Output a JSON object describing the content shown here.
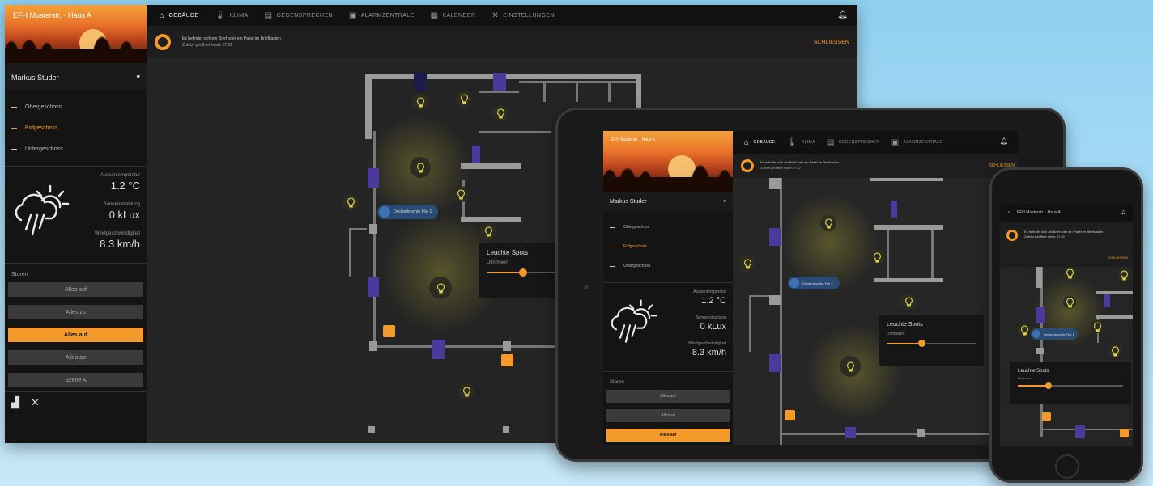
{
  "desktop": {
    "sidebar": {
      "header": "EFH Musterstr. · Haus A",
      "user": "Markus Studer",
      "floors": [
        {
          "label": "Obergeschoss",
          "active": false
        },
        {
          "label": "Erdgeschoss",
          "active": true
        },
        {
          "label": "Untergeschoss",
          "active": false
        }
      ],
      "weather": {
        "icon": "cloud-rain-sun-icon",
        "temp_label": "Aussentemperatur",
        "temp_value": "1.2 °C",
        "light_label": "Sonnenstrahlung",
        "light_value": "0 kLux",
        "wind_label": "Windgeschwindigkeit",
        "wind_value": "8.3 km/h"
      },
      "group_title": "Storen",
      "group_buttons": [
        {
          "label": "Alles auf",
          "active": false
        },
        {
          "label": "Alles zu",
          "active": false
        },
        {
          "label": "Alles auf",
          "active": true
        },
        {
          "label": "Alles ab",
          "active": false
        },
        {
          "label": "Szene A",
          "active": false
        }
      ]
    },
    "nav": [
      {
        "label": "GEBÄUDE",
        "icon": "home-icon",
        "active": true
      },
      {
        "label": "KLIMA",
        "icon": "thermometer-icon",
        "active": false
      },
      {
        "label": "GEGENSPRECHEN",
        "icon": "intercom-icon",
        "active": false
      },
      {
        "label": "ALARMZENTRALE",
        "icon": "alarm-icon",
        "active": false
      },
      {
        "label": "KALENDER",
        "icon": "calendar-icon",
        "active": false
      },
      {
        "label": "EINSTELLUNGEN",
        "icon": "tools-icon",
        "active": false
      }
    ],
    "notification": {
      "line1": "Es befindet sich ein Brief oder ein Paket im Briefkasten",
      "line2": "Zuletzt geöffnet heute 07:32",
      "close": "SCHLIESSEN"
    },
    "device_bubble": "Deckenleuchte Flur 1",
    "slider_popup": {
      "title": "Leuchte Spots",
      "subtitle": "Dimmwert",
      "value": 0.5
    }
  },
  "tablet": {
    "sidebar": {
      "header": "EFH Musterstr. · Haus A",
      "user": "Markus Studer",
      "floors": [
        {
          "label": "Obergeschoss",
          "active": false
        },
        {
          "label": "Erdgeschoss",
          "active": true
        },
        {
          "label": "Untergeschoss",
          "active": false
        }
      ],
      "weather": {
        "temp_label": "Aussentemperatur",
        "temp_value": "1.2 °C",
        "light_label": "Sonnenstrahlung",
        "light_value": "0 kLux",
        "wind_label": "Windgeschwindigkeit",
        "wind_value": "8.3 km/h"
      },
      "group_title": "Storen",
      "group_buttons": [
        {
          "label": "Alles auf",
          "active": false
        },
        {
          "label": "Alles zu",
          "active": false
        },
        {
          "label": "Alles auf",
          "active": true
        }
      ]
    },
    "nav": [
      {
        "label": "GEBÄUDE",
        "active": true
      },
      {
        "label": "KLIMA",
        "active": false
      },
      {
        "label": "GEGENSPRECHEN",
        "active": false
      },
      {
        "label": "ALARMZENTRALE",
        "active": false
      }
    ],
    "notification": {
      "line1": "Es befindet sich ein Brief oder ein Paket im Briefkasten",
      "line2": "Zuletzt geöffnet heute 07:32",
      "close": "SCHLIESSEN"
    },
    "device_bubble": "Deckenleuchte Flur 1",
    "slider_popup": {
      "title": "Leuchte Spots",
      "subtitle": "Dimmwert",
      "value": 0.4
    }
  },
  "phone": {
    "header": "EFH Musterstr. · Haus A",
    "notification": {
      "line1": "Es befindet sich ein Brief oder ein Paket im Briefkasten",
      "line2": "Zuletzt geöffnet heute 07:32",
      "close": "SCHLIESSEN"
    },
    "device_bubble": "Deckenleuchte Flur 1",
    "slider_popup": {
      "title": "Leuchte Spots",
      "subtitle": "Dimmwert",
      "value": 0.3
    }
  },
  "colors": {
    "accent": "#f39a2b",
    "blind": "#4b3a9c",
    "bulb": "#e2d74a",
    "background_dark": "#242424"
  }
}
